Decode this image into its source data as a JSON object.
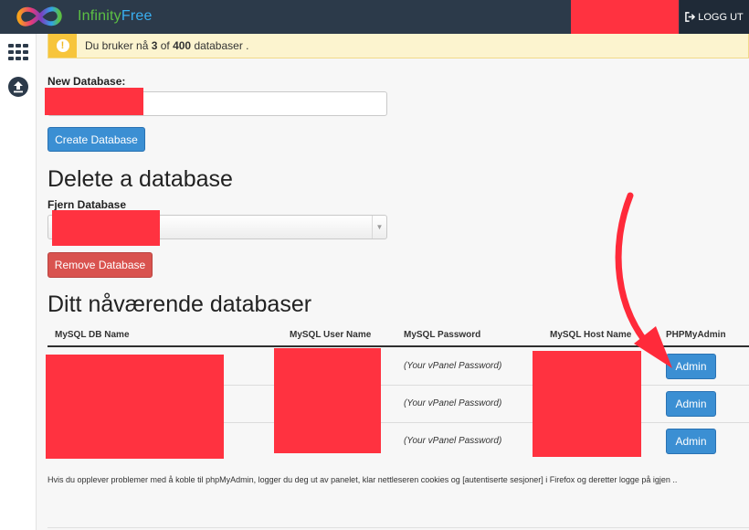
{
  "header": {
    "brand_part1": "Infinity",
    "brand_part2": "Free",
    "logout_label": "LOGG UT"
  },
  "sidebar": {
    "items": [
      {
        "icon": "grid-icon"
      },
      {
        "icon": "upload-icon"
      }
    ]
  },
  "alert": {
    "prefix": "Du bruker nå ",
    "used": "3",
    "middle": " of ",
    "limit": "400",
    "suffix": " databaser ."
  },
  "create": {
    "label": "New Database:",
    "button": "Create Database"
  },
  "delete": {
    "heading": "Delete a database",
    "label": "Fjern Database",
    "button": "Remove Database"
  },
  "databases": {
    "heading": "Ditt nåværende databaser",
    "columns": [
      "MySQL DB Name",
      "MySQL User Name",
      "MySQL Password",
      "MySQL Host Name",
      "PHPMyAdmin"
    ],
    "rows": [
      {
        "password": "(Your vPanel Password)",
        "action": "Admin"
      },
      {
        "password": "(Your vPanel Password)",
        "action": "Admin"
      },
      {
        "password": "(Your vPanel Password)",
        "action": "Admin"
      }
    ]
  },
  "footnote": "Hvis du opplever problemer med å koble til phpMyAdmin, logger du deg ut av panelet, klar nettleseren cookies og [autentiserte sesjoner] i Firefox og deretter logge på igjen ..",
  "colors": {
    "topbar": "#2c3a4a",
    "primary_button": "#3b8fd3",
    "danger_button": "#d9534f",
    "redaction": "#ff3240",
    "annotation_arrow": "#ff2a3a"
  }
}
